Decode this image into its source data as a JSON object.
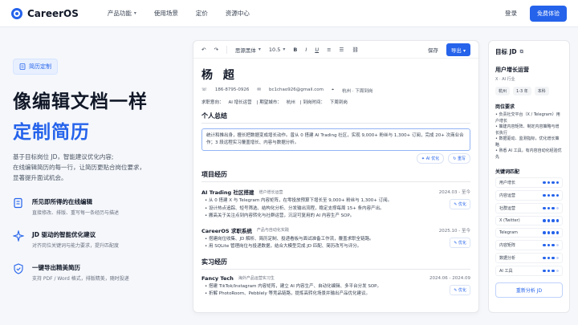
{
  "nav": {
    "brand": "CareerOS",
    "menu": [
      "产品功能",
      "使用场景",
      "定价",
      "资源中心"
    ],
    "login": "登录",
    "trial": "免费体验"
  },
  "hero": {
    "tag": "简历定制",
    "title1": "像编辑文档一样",
    "title2": "定制简历",
    "sub1": "基于目标岗位 JD，智能建议优化内容;",
    "sub2": "在线编辑简历的每一行，让简历更贴合岗位要求，",
    "sub3": "显著提升面试机会。",
    "features": [
      {
        "title": "所见即所得的在线编辑",
        "desc": "直接修改、排版、重写每一条经历与描述"
      },
      {
        "title": "JD 驱动的智能优化建议",
        "desc": "对齐岗位关键词与能力要求，提升匹配度"
      },
      {
        "title": "一键导出精美简历",
        "desc": "支持 PDF / Word 格式，排版精美，随时投递"
      }
    ]
  },
  "toolbar": {
    "font": "思源黑体",
    "size": "10.5",
    "save": "保存",
    "export": "导出"
  },
  "resume": {
    "name": "杨 超",
    "phone": "186-8795-0926",
    "email": "bc1chao926@gmail.com",
    "city": "杭州 · 下周到岗",
    "intent_label": "求职意向：",
    "intent_role": "AI 增长运营",
    "city_label": "| 期望城市：",
    "city_value": "杭州",
    "arrive_label": "| 到岗时间：",
    "arrive_value": "下周到岗",
    "summary_title": "个人总结",
    "summary_text": "统计和推出身，擅长把数据变成增长动作。曾从 0 搭建 AI Trading 社区，实现 9,000+ 粉丝与 1,300+ 订阅，完成 20+ 次商业合作；3 段远程实习覆盖增长、内容与数据分析。",
    "ai_opt": "AI 优化",
    "rewrite": "重写",
    "projects_title": "项目经历",
    "projects": [
      {
        "title": "AI Trading 社区搭建",
        "role": "增户增长运营",
        "date": "2024.03 - 至今",
        "bullets": [
          "从 0 搭建 X 与 Telegram 内容矩阵，在零投放预算下增长至 9,000+ 粉丝与 1,300+ 订阅。",
          "设计热点追踪、短号筛选、结构化分析、分发输出流程，稳定支撑每周 15+ 条内容产出。",
          "搬高关于关注点到内容转化与社群运营，沉淀可复用的 AI 内容生产 SOP。"
        ],
        "opt": "优化"
      },
      {
        "title": "CareerOS 求职系统",
        "role": "产品与自动化实践",
        "date": "2025.10 - 至今",
        "bullets": [
          "搭建岗位收集、JD 解析、简历定制、投递看板与面试准备工作流，覆盖求职全链路。",
          "用 SQLite 管理岗位与投递数据，结合大模型完成 JD 匹配、简历改写与评分。"
        ],
        "opt": "优化"
      }
    ],
    "intern_title": "实习经历",
    "interns": [
      {
        "title": "Fancy Tech",
        "role": "海外产品运营实习生",
        "date": "2024.06 - 2024.09",
        "bullets": [
          "搭建 TikTok/Instagram 内容矩阵，建立 AI 内容生产、自动化编辑、多平台分发 SOP。",
          "折解 PhotoRoom、Pebblely 等竞品链路，提炼高转化场景并输出产品优化建议。"
        ],
        "opt": "优化"
      }
    ]
  },
  "aside": {
    "title": "目标 JD",
    "role": "用户增长运营",
    "role_sub": "X · AI 行业",
    "chips": [
      "杭州",
      "1-3 年",
      "本科"
    ],
    "duties_title": "岗位要求",
    "duties": [
      "负责社交平台（X / Telegram）用户增长",
      "策建内容矩阵、制定内容策略与增长执行",
      "数据驱动、监测指标，优化增长策略",
      "熟悉 AI 工具，有内容自动化经验优先"
    ],
    "kw_title": "关键词匹配",
    "keywords": [
      {
        "name": "用户增长",
        "level": 4
      },
      {
        "name": "内容运营",
        "level": 4
      },
      {
        "name": "社群运营",
        "level": 3
      },
      {
        "name": "X (Twitter)",
        "level": 4
      },
      {
        "name": "Telegram",
        "level": 4
      },
      {
        "name": "内容矩阵",
        "level": 3
      },
      {
        "name": "数据分析",
        "level": 3
      },
      {
        "name": "AI 工具",
        "level": 3
      }
    ],
    "reanalyze": "重新分析 JD"
  },
  "colors": {
    "accent": "#2563eb"
  }
}
